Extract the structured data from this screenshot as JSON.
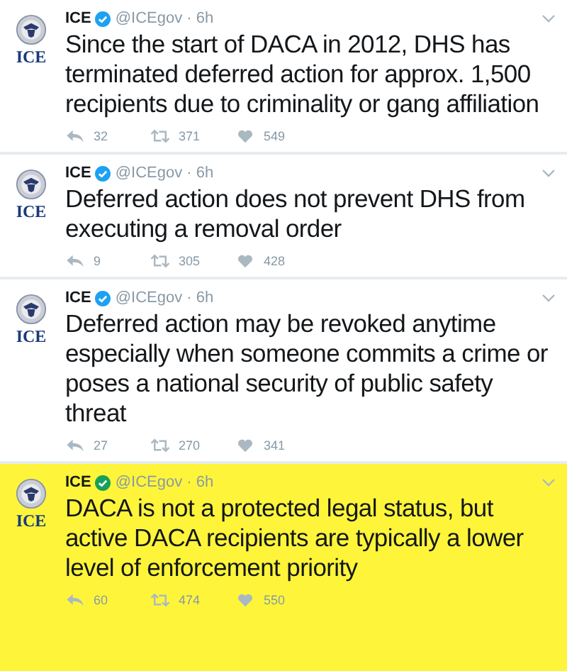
{
  "tweets": [
    {
      "name": "ICE",
      "avatar_label": "ICE",
      "handle": "@ICEgov · 6h",
      "verified": true,
      "highlighted": false,
      "text": "Since the start of DACA in 2012, DHS has terminated deferred action for approx. 1,500 recipients due to criminality or gang affiliation",
      "replies": "32",
      "retweets": "371",
      "likes": "549"
    },
    {
      "name": "ICE",
      "avatar_label": "ICE",
      "handle": "@ICEgov · 6h",
      "verified": true,
      "highlighted": false,
      "text": "Deferred action does not prevent DHS from executing a removal order",
      "replies": "9",
      "retweets": "305",
      "likes": "428"
    },
    {
      "name": "ICE",
      "avatar_label": "ICE",
      "handle": "@ICEgov · 6h",
      "verified": true,
      "highlighted": false,
      "text": "Deferred action may be revoked anytime especially when someone commits a crime or poses a national security of public safety threat",
      "replies": "27",
      "retweets": "270",
      "likes": "341"
    },
    {
      "name": "ICE",
      "avatar_label": "ICE",
      "handle": "@ICEgov · 6h",
      "verified": true,
      "highlighted": true,
      "text": "DACA is not a protected legal status, but active DACA recipients are typically a lower level of enforcement priority",
      "replies": "60",
      "retweets": "474",
      "likes": "550"
    }
  ]
}
